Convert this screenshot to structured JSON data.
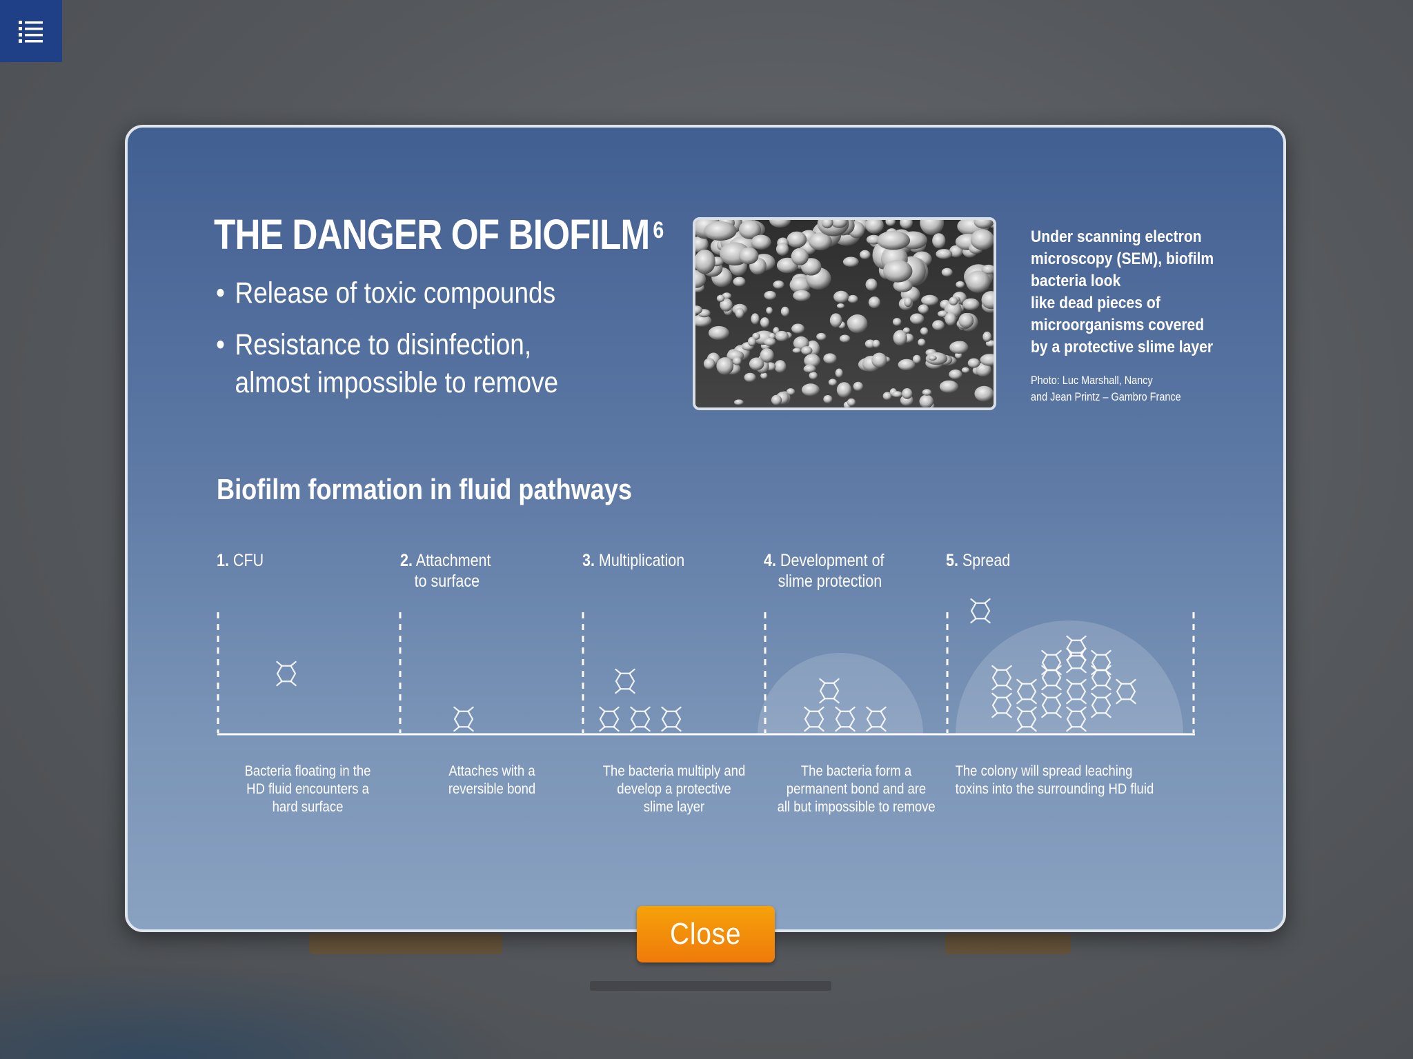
{
  "menu": {
    "icon": "list-icon"
  },
  "modal": {
    "title": "THE DANGER OF BIOFILM",
    "title_sup": "6",
    "bullets": [
      "Release of toxic compounds",
      "Resistance to disinfection,",
      "almost impossible to remove"
    ],
    "photo": {
      "alt": "SEM image of biofilm bacteria"
    },
    "caption": [
      "Under scanning electron",
      "microscopy (SEM), biofilm",
      "bacteria look",
      "like dead pieces of",
      "microorganisms covered",
      "by a protective slime layer"
    ],
    "credit": [
      "Photo: Luc Marshall, Nancy",
      "and Jean Printz – Gambro France"
    ],
    "subheading": "Biofilm formation in fluid pathways",
    "steps": [
      {
        "num": "1.",
        "label": "CFU",
        "label2": "",
        "desc": [
          "Bacteria floating in the",
          "HD fluid encounters a",
          "hard surface"
        ]
      },
      {
        "num": "2.",
        "label": "Attachment",
        "label2": "to surface",
        "desc": [
          "Attaches with a",
          "reversible bond",
          ""
        ]
      },
      {
        "num": "3.",
        "label": "Multiplication",
        "label2": "",
        "desc": [
          "The bacteria multiply and",
          "develop a protective",
          "slime layer"
        ]
      },
      {
        "num": "4.",
        "label": "Development of",
        "label2": "slime protection",
        "desc": [
          "The bacteria form a",
          "permanent bond and are",
          "all but impossible to remove"
        ]
      },
      {
        "num": "5.",
        "label": "Spread",
        "label2": "",
        "desc": [
          "The colony will spread leaching",
          "toxins into the surrounding HD fluid",
          ""
        ]
      }
    ],
    "close_label": "Close"
  },
  "colors": {
    "menu_bg": "#1f3f86",
    "modal_top": "#425f92",
    "modal_bottom": "#8aa2c1",
    "close_btn": "#f28a0a"
  }
}
